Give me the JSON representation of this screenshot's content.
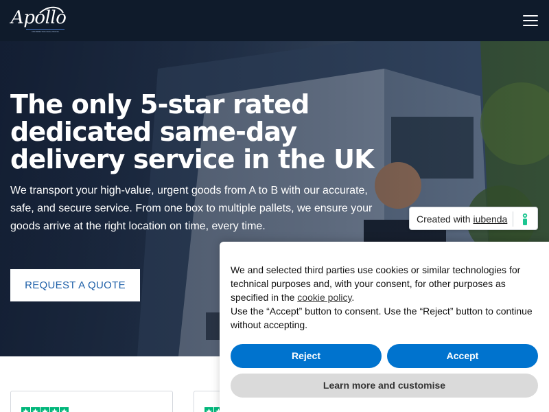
{
  "header": {
    "logo_text": "Apollo",
    "logo_tagline": "DISTRIBUTION SOLUTIONS",
    "menu_icon": "hamburger-menu-icon"
  },
  "hero": {
    "title": "The only 5-star rated dedicated same-day delivery service in the UK",
    "subtitle": "We transport your high-value, urgent goods from A to B with our accurate, safe, and secure service. From one box to multiple pallets, we ensure your goods arrive at the right location on time, every time.",
    "cta_label": "REQUEST A QUOTE"
  },
  "review_cards": {
    "rating_stars": 5,
    "star_color": "#00b67a"
  },
  "iubenda_badge": {
    "prefix": "Created with ",
    "brand": "iubenda",
    "icon": "iubenda-icon"
  },
  "cookie_banner": {
    "text_1": "We and selected third parties use cookies or similar technologies for technical purposes and, with your consent, for other purposes as specified in the ",
    "policy_link": "cookie policy",
    "text_2": ".",
    "text_3": "Use the “Accept” button to consent. Use the “Reject” button to continue without accepting.",
    "reject_label": "Reject",
    "accept_label": "Accept",
    "learn_label": "Learn more and customise"
  },
  "colors": {
    "navbar": "#0f1b2b",
    "primary_button": "#0073ce",
    "cta_text": "#1d5fa8"
  }
}
